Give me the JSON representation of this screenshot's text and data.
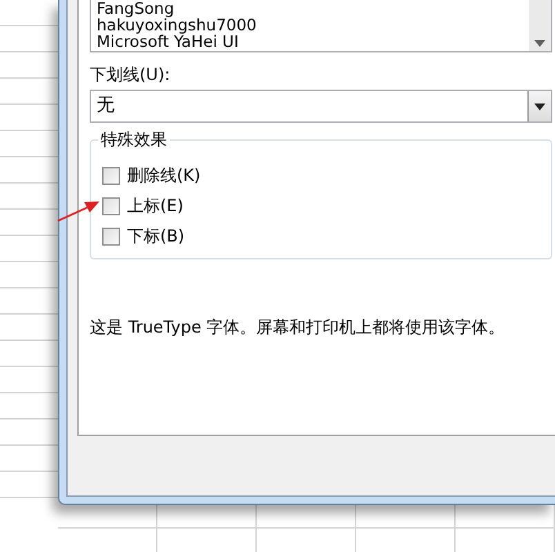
{
  "font_list": {
    "items": [
      "FangSong",
      "hakuyoxingshu7000",
      "Microsoft YaHei UI"
    ]
  },
  "underline": {
    "label": "下划线(U):",
    "value": "无"
  },
  "effects": {
    "title": "特殊效果",
    "options": [
      {
        "label": "删除线(K)",
        "checked": false
      },
      {
        "label": "上标(E)",
        "checked": false
      },
      {
        "label": "下标(B)",
        "checked": false
      }
    ]
  },
  "description": "这是 TrueType 字体。屏幕和打印机上都将使用该字体。"
}
